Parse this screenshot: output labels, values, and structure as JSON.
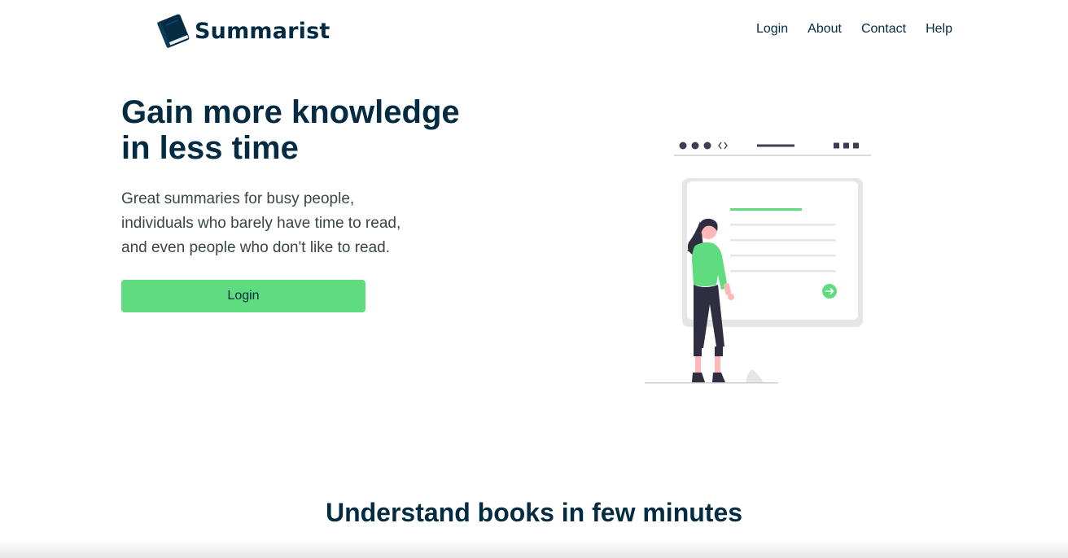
{
  "brand": {
    "name": "Summarist",
    "logo_icon": "book-icon"
  },
  "nav": {
    "links": [
      "Login",
      "About",
      "Contact",
      "Help"
    ]
  },
  "hero": {
    "title_line1": "Gain more knowledge",
    "title_line2": "in less time",
    "subtitle_line1": "Great summaries for busy people,",
    "subtitle_line2": "individuals who barely have time to read,",
    "subtitle_line3": "and even people who don't like to read.",
    "button_label": "Login",
    "illustration": "person-reading-browser-illustration"
  },
  "features": {
    "title": "Understand books in few minutes"
  },
  "colors": {
    "primary": "#032b41",
    "accent": "#5fdc7f",
    "text_secondary": "#394547"
  }
}
